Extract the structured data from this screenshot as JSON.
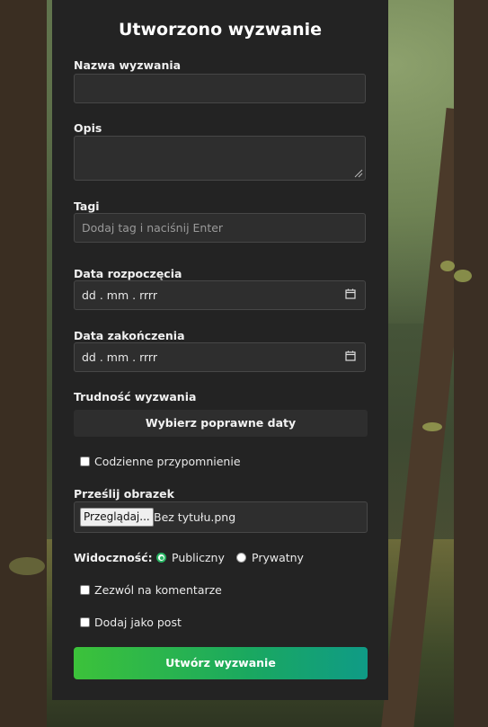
{
  "form": {
    "title": "Utworzono wyzwanie",
    "name_label": "Nazwa wyzwania",
    "name_value": "",
    "description_label": "Opis",
    "description_value": "",
    "tags_label": "Tagi",
    "tags_placeholder": "Dodaj tag i naciśnij Enter",
    "start_date_label": "Data rozpoczęcia",
    "start_date_value": "dd . mm . rrrr",
    "end_date_label": "Data zakończenia",
    "end_date_value": "dd . mm . rrrr",
    "difficulty_label": "Trudność wyzwania",
    "difficulty_button": "Wybierz poprawne daty",
    "daily_reminder_label": "Codzienne przypomnienie",
    "upload_label": "Prześlij obrazek",
    "browse_button": "Przeglądaj...",
    "file_name": "Bez tytułu.png",
    "visibility_label": "Widoczność:",
    "visibility_options": [
      "Publiczny",
      "Prywatny"
    ],
    "visibility_selected": "Publiczny",
    "allow_comments_label": "Zezwól na komentarze",
    "add_as_post_label": "Dodaj jako post",
    "submit_button": "Utwórz wyzwanie"
  },
  "colors": {
    "card_bg": "#232323",
    "field_bg": "#2e2e2e",
    "accent_green": "#28b463",
    "submit_gradient_start": "#3cc23a",
    "submit_gradient_end": "#0f9b86"
  }
}
